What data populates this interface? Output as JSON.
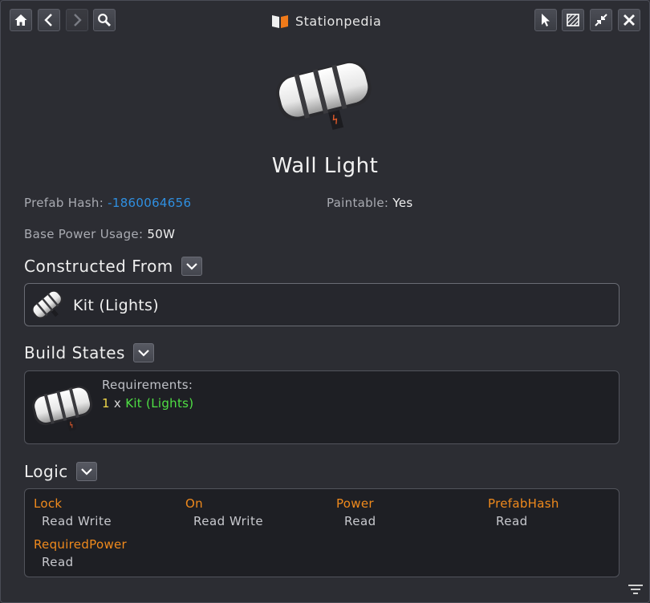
{
  "window": {
    "title": "Stationpedia",
    "title_icon": "book-icon",
    "nav_buttons": [
      "home-icon",
      "back-icon",
      "forward-icon",
      "search-icon"
    ],
    "window_buttons": [
      "cursor-icon",
      "hatch-icon",
      "shrink-icon",
      "close-icon"
    ]
  },
  "item": {
    "name": "Wall Light",
    "prefab_hash_label": "Prefab Hash:",
    "prefab_hash": "-1860064656",
    "paintable_label": "Paintable:",
    "paintable": "Yes",
    "power_label": "Base Power Usage:",
    "power": "50W"
  },
  "constructed_from": {
    "heading": "Constructed From",
    "items": [
      "Kit (Lights)"
    ]
  },
  "build_states": {
    "heading": "Build States",
    "requirements_label": "Requirements:",
    "requirement": {
      "qty": "1",
      "x": "x",
      "item": "Kit (Lights)"
    }
  },
  "logic": {
    "heading": "Logic",
    "entries": [
      {
        "name": "Lock",
        "mode": "Read Write"
      },
      {
        "name": "On",
        "mode": "Read Write"
      },
      {
        "name": "Power",
        "mode": "Read"
      },
      {
        "name": "PrefabHash",
        "mode": "Read"
      },
      {
        "name": "RequiredPower",
        "mode": "Read"
      }
    ]
  },
  "colors": {
    "hash": "#2f8fe0",
    "logic_name": "#f08a1c",
    "req_qty": "#f0d84a",
    "req_item": "#4fe044"
  }
}
